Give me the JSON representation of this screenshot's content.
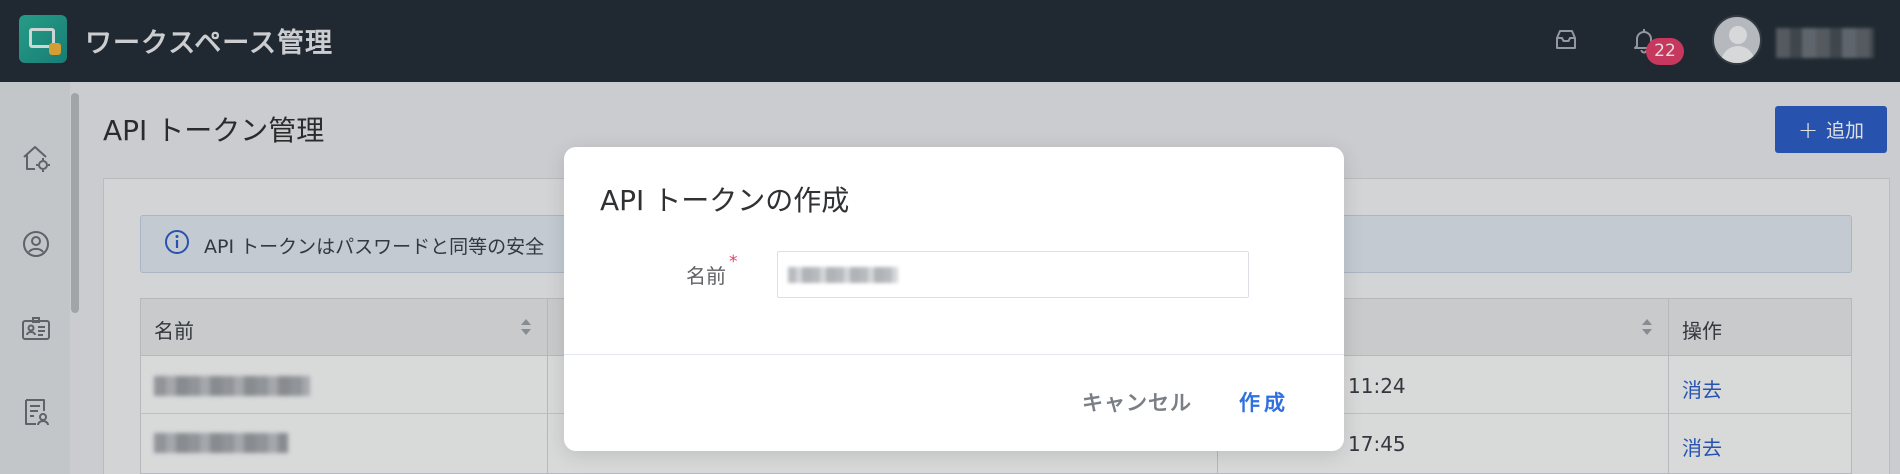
{
  "header": {
    "app_title": "ワークスペース管理",
    "notification_count": "22",
    "icons": [
      "app-logo-icon",
      "inbox-icon",
      "bell-icon",
      "avatar-icon"
    ]
  },
  "sidebar": {
    "icons": [
      "home-settings-icon",
      "user-circle-icon",
      "id-card-icon",
      "document-user-icon"
    ]
  },
  "main": {
    "page_title": "API トークン管理",
    "add_button_label": "追加",
    "notice_text": "API トークンはパスワードと同等の安全",
    "table": {
      "header_name": "名前",
      "header_ops": "操作",
      "rows": [
        {
          "time": "11:24",
          "op": "消去"
        },
        {
          "time": "17:45",
          "op": "消去"
        }
      ]
    }
  },
  "modal": {
    "title": "API トークンの作成",
    "name_label": "名前",
    "required_mark": "*",
    "cancel_label": "キャンセル",
    "create_label": "作成"
  },
  "colors": {
    "header_bg": "#252f38",
    "primary": "#2d5fc8",
    "badge": "#e3406c",
    "link": "#2f6fe0"
  }
}
